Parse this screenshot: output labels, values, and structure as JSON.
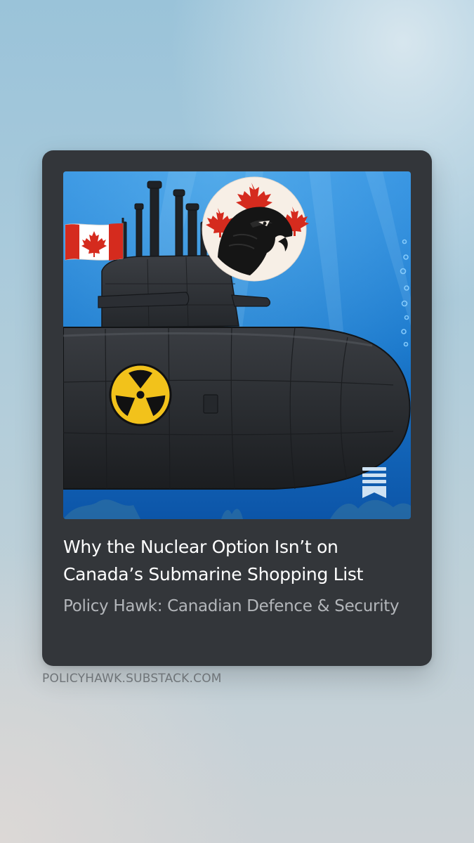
{
  "post": {
    "title": "Why the Nuclear Option Isn’t on Canada’s Submarine Shopping List",
    "publication": "Policy Hawk: Canadian Defence & Security",
    "domain": "POLICYHAWK.SUBSTACK.COM",
    "image_alt": "Illustration of a black nuclear submarine with a radiation symbol, a Canadian flag on the sail, and the Policy Hawk hawk-and-maple-leaf logo"
  },
  "icons": {
    "bookmark": "bookmark-icon",
    "flag": "canada-flag",
    "logo": "policy-hawk-logo",
    "radiation": "radiation-symbol"
  },
  "colors": {
    "card_background": "#33363a",
    "title": "#ffffff",
    "publication": "#b3b6ba",
    "domain": "#6f7478",
    "ocean": "#1f7ac8",
    "submarine": "#2a2d31",
    "radiation_yellow": "#f2c21b",
    "maple_red": "#d52b1e"
  }
}
